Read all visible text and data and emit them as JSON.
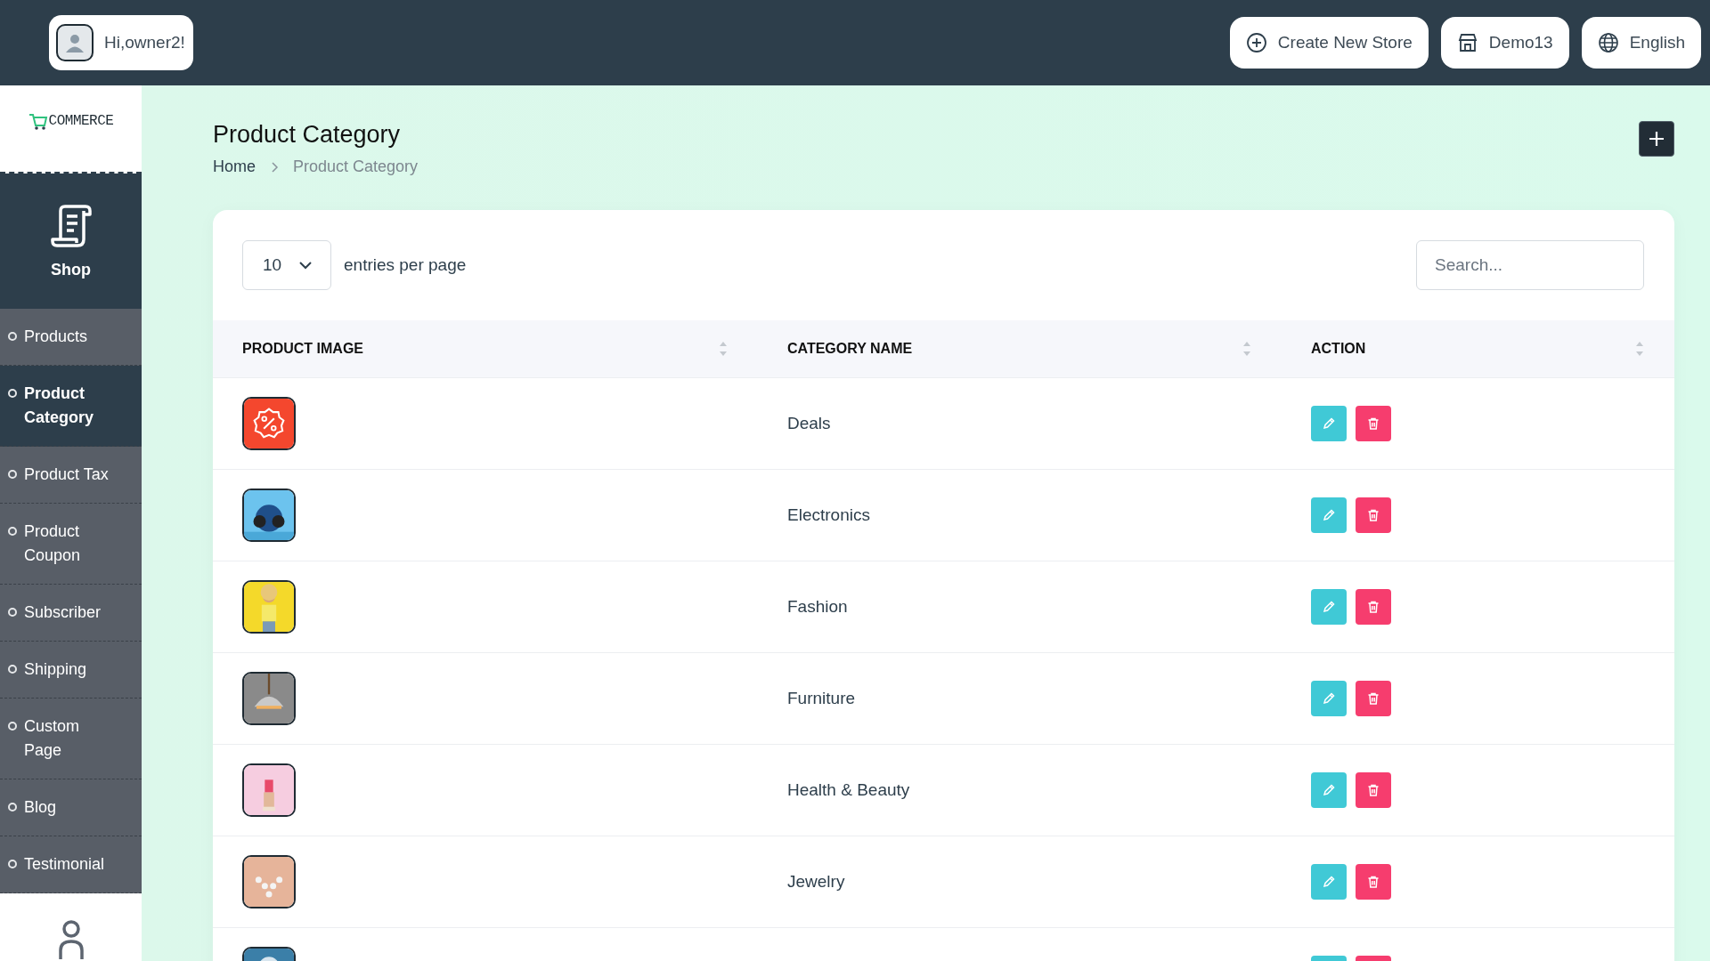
{
  "header": {
    "greeting": "Hi,owner2!",
    "buttons": [
      {
        "kind": "create",
        "label": "Create New Store"
      },
      {
        "kind": "store",
        "label": "Demo13"
      },
      {
        "kind": "language",
        "label": "English"
      }
    ]
  },
  "sidebar": {
    "logo": "COMMERCE",
    "section": {
      "label": "Shop"
    },
    "items": [
      {
        "label": "Products",
        "selected": false
      },
      {
        "label": "Product Category",
        "selected": true
      },
      {
        "label": "Product Tax",
        "selected": false
      },
      {
        "label": "Product Coupon",
        "selected": false
      },
      {
        "label": "Subscriber",
        "selected": false
      },
      {
        "label": "Shipping",
        "selected": false
      },
      {
        "label": "Custom Page",
        "selected": false
      },
      {
        "label": "Blog",
        "selected": false
      },
      {
        "label": "Testimonial",
        "selected": false
      }
    ]
  },
  "page": {
    "title": "Product Category",
    "breadcrumb": [
      "Home",
      "Product Category"
    ]
  },
  "table": {
    "page_size": "10",
    "page_size_label": "entries per page",
    "search": {
      "placeholder": "Search..."
    },
    "columns": [
      "PRODUCT IMAGE",
      "CATEGORY NAME",
      "ACTION"
    ],
    "rows": [
      {
        "kind": "icon",
        "name": "Deals"
      },
      {
        "kind": "picture",
        "name": "Electronics"
      },
      {
        "kind": "picture",
        "name": "Fashion"
      },
      {
        "kind": "picture",
        "name": "Furniture"
      },
      {
        "kind": "picture",
        "name": "Health & Beauty"
      },
      {
        "kind": "picture",
        "name": "Jewelry"
      },
      {
        "kind": "picture"
      }
    ]
  }
}
